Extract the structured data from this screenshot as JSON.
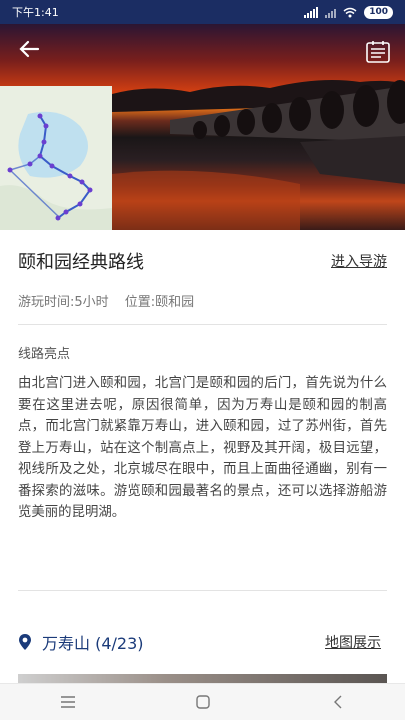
{
  "status": {
    "time": "下午1:41",
    "battery": "100"
  },
  "header": {
    "back_icon": "arrow-left-icon",
    "menu_icon": "list-icon"
  },
  "route": {
    "title": "颐和园经典路线",
    "nav_link": "进入导游",
    "play_time": "游玩时间:5小时",
    "location": "位置:颐和园"
  },
  "highlights": {
    "label": "线路亮点",
    "text": "由北宫门进入颐和园，北宫门是颐和园的后门，首先说为什么要在这里进去呢，原因很简单，因为万寿山是颐和园的制高点，而北宫门就紧靠万寿山，进入颐和园，过了苏州街，首先登上万寿山，站在这个制高点上，视野及其开阔，极目远望，视线所及之处，北京城尽在眼中，而且上面曲径通幽，别有一番探索的滋味。游览颐和园最著名的景点，还可以选择游船游览美丽的昆明湖。"
  },
  "stop": {
    "name": "万寿山 (4/23)",
    "map_link": "地图展示",
    "icon": "location-pin-icon"
  },
  "navbar": {
    "menu_icon": "menu-icon",
    "home_icon": "home-icon",
    "back_icon": "back-icon"
  },
  "colors": {
    "status_bar": "#1b2d63",
    "stop_accent": "#1b3b7a"
  }
}
